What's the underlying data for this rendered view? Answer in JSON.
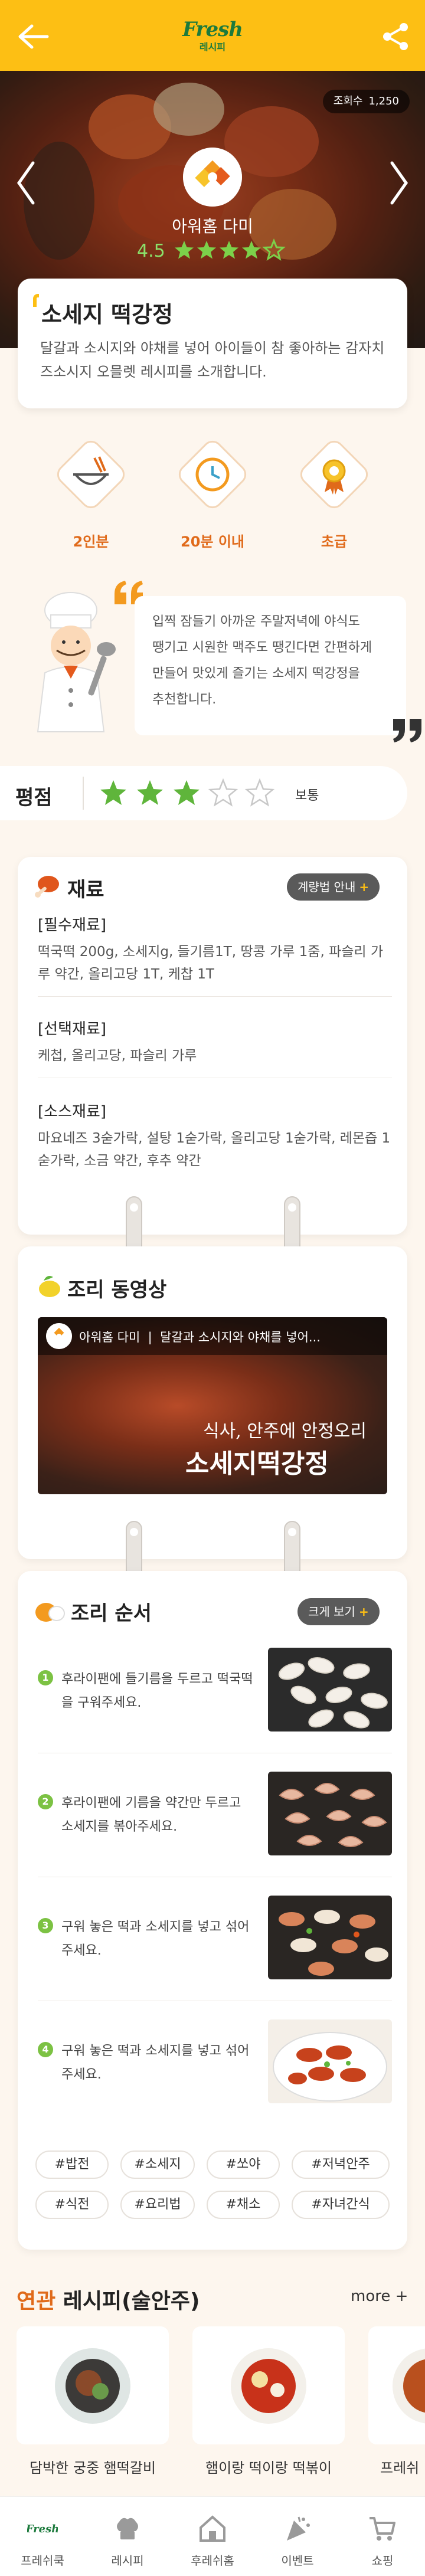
{
  "header": {
    "logo_main": "Fresh",
    "logo_sub": "레시피"
  },
  "hero": {
    "views_label": "조회수",
    "views_count": "1,250",
    "creator": "아워홈 다미",
    "rating": "4.5"
  },
  "recipe": {
    "title": "소세지 떡강정",
    "description": "달갈과 소시지와 야채를 넣어 아이들이 참 좋아하는 감자치즈소시지 오믈렛 레시피를 소개합니다."
  },
  "info": [
    {
      "icon": "bowl-icon",
      "label": "2인분"
    },
    {
      "icon": "clock-icon",
      "label": "20분 이내"
    },
    {
      "icon": "medal-icon",
      "label": "초급"
    }
  ],
  "chef": {
    "lines": [
      "입찍 잠들기 아까운 주말저녁에 야식도",
      "땡기고 시원한 맥주도 땡긴다면 간편하게",
      "만들어 맛있게 즐기는 소세지 떡강정을",
      "추천합니다."
    ]
  },
  "rating": {
    "label": "평점",
    "stars": 3,
    "max": 5,
    "text": "보통"
  },
  "ingredients": {
    "title": "재료",
    "guide_button": "계량법 안내",
    "sections": [
      {
        "heading": "[필수재료]",
        "body": "떡국떡 200g, 소세지g, 들기름1T, 땅콩 가루 1줌, 파슬리 가루 약간, 올리고당 1T, 케찹 1T"
      },
      {
        "heading": "[선택재료]",
        "body": "케첩, 올리고당, 파슬리 가루"
      },
      {
        "heading": "[소스재료]",
        "body": "마요네즈 3숟가락, 설탕 1숟가락, 올리고당 1숟가락, 레몬즙 1숟가락, 소금 약간, 후추 약간"
      }
    ]
  },
  "video": {
    "title": "조리 동영상",
    "channel": "아워홈 다미",
    "video_title": "달갈과 소시지와 야채를 넣어...",
    "caption1": "식사, 안주에 안정오리",
    "caption2": "소세지떡강정"
  },
  "steps": {
    "title": "조리 순서",
    "view_button": "크게 보기",
    "items": [
      {
        "num": "1",
        "text": "후라이팬에 들기름을 두르고 떡국떡을 구워주세요."
      },
      {
        "num": "2",
        "text": "후라이팬에 기름을 약간만 두르고 소세지를 볶아주세요."
      },
      {
        "num": "3",
        "text": "구워 놓은 떡과 소세지를 넣고 섞어주세요."
      },
      {
        "num": "4",
        "text": "구워 놓은 떡과 소세지를 넣고 섞어주세요."
      }
    ]
  },
  "tags": [
    "#밥전",
    "#소세지",
    "#쏘야",
    "#저녁안주",
    "#식전",
    "#요리법",
    "#채소",
    "#자녀간식"
  ],
  "related": {
    "title_prefix": "연관",
    "title_rest": "레시피(술안주)",
    "more": "more +",
    "items": [
      "담박한 궁중 햄떡갈비",
      "햄이랑 떡이랑 떡볶이",
      "프레쉬"
    ]
  },
  "nav": [
    {
      "label": "프레쉬쿡",
      "icon": "fresh-logo-icon"
    },
    {
      "label": "레시피",
      "icon": "chef-hat-icon"
    },
    {
      "label": "후레쉬홈",
      "icon": "home-icon"
    },
    {
      "label": "이벤트",
      "icon": "party-icon"
    },
    {
      "label": "쇼핑",
      "icon": "cart-icon"
    }
  ],
  "colors": {
    "brand_yellow": "#fdbf14",
    "brand_green": "#1c7a3c",
    "accent_orange": "#e06a1a",
    "star_green": "#5fb53b"
  }
}
